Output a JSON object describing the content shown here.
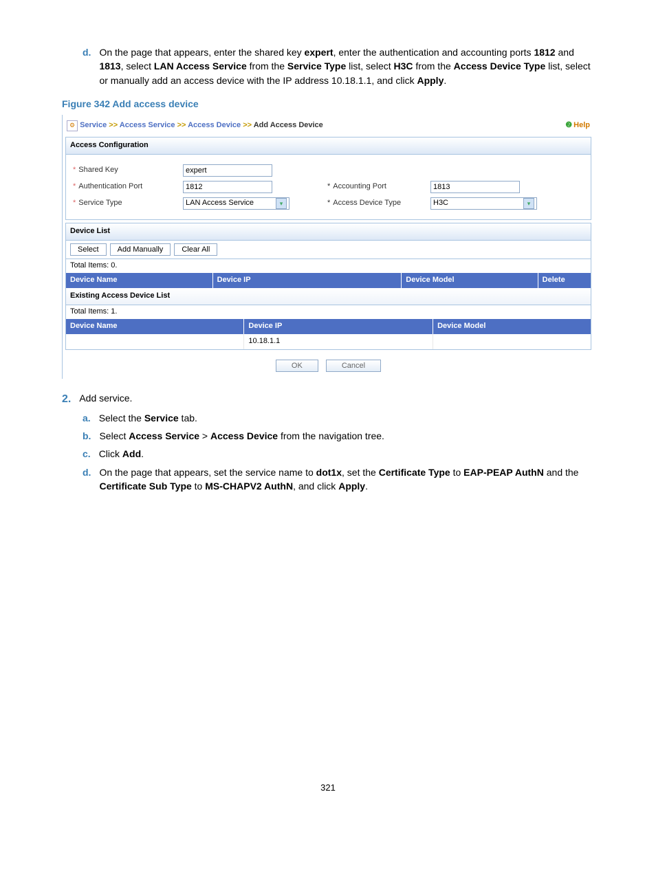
{
  "step_d": {
    "letter": "d.",
    "text_1": "On the page that appears, enter the shared key ",
    "key": "expert",
    "text_2": ", enter the authentication and accounting ports ",
    "port1": "1812",
    "and": " and ",
    "port2": "1813",
    "text_3": ", select ",
    "lan": "LAN Access Service",
    "text_4": " from the ",
    "svc": "Service Type",
    "text_5": " list, select ",
    "h3c": "H3C",
    "text_6": " from the ",
    "adt": "Access Device Type",
    "text_7": " list, select or manually add an access device with the IP address 10.18.1.1, and click ",
    "apply": "Apply",
    "period": "."
  },
  "figure_caption": "Figure 342 Add access device",
  "screenshot": {
    "breadcrumb": {
      "service": "Service",
      "access_service": "Access Service",
      "access_device": "Access Device",
      "add": "Add Access Device",
      "sep": " >> "
    },
    "help": "Help",
    "panel_title": "Access Configuration",
    "labels": {
      "shared_key": "Shared Key",
      "auth_port": "Authentication Port",
      "acct_port": "Accounting Port",
      "service_type": "Service Type",
      "access_dev_type": "Access Device Type"
    },
    "values": {
      "shared_key": "expert",
      "auth_port": "1812",
      "acct_port": "1813",
      "service_type": "LAN Access Service",
      "access_dev_type": "H3C"
    },
    "device_list": {
      "title": "Device List",
      "select_btn": "Select",
      "add_btn": "Add Manually",
      "clear_btn": "Clear All",
      "total": "Total Items: 0.",
      "cols": {
        "name": "Device Name",
        "ip": "Device IP",
        "model": "Device Model",
        "delete": "Delete"
      }
    },
    "existing": {
      "title": "Existing Access Device List",
      "total": "Total Items: 1.",
      "cols": {
        "name": "Device Name",
        "ip": "Device IP",
        "model": "Device Model"
      },
      "row": {
        "name": "",
        "ip": "10.18.1.1",
        "model": ""
      }
    },
    "ok": "OK",
    "cancel": "Cancel"
  },
  "step2": {
    "num": "2.",
    "text": "Add service."
  },
  "step2a": {
    "letter": "a.",
    "t1": "Select the ",
    "b1": "Service",
    "t2": " tab."
  },
  "step2b": {
    "letter": "b.",
    "t1": "Select ",
    "b1": "Access Service",
    "sep": " > ",
    "b2": "Access Device",
    "t2": " from the navigation tree."
  },
  "step2c": {
    "letter": "c.",
    "t1": "Click ",
    "b1": "Add",
    "t2": "."
  },
  "step2d": {
    "letter": "d.",
    "t1": "On the page that appears, set the service name to ",
    "b1": "dot1x",
    "t2": ", set the ",
    "b2": "Certificate Type",
    "t3": " to ",
    "b3": "EAP-PEAP AuthN",
    "t4": " and the ",
    "b4": "Certificate Sub Type",
    "t5": " to ",
    "b5": "MS-CHAPV2 AuthN",
    "t6": ", and click ",
    "b6": "Apply",
    "t7": "."
  },
  "page_number": "321"
}
